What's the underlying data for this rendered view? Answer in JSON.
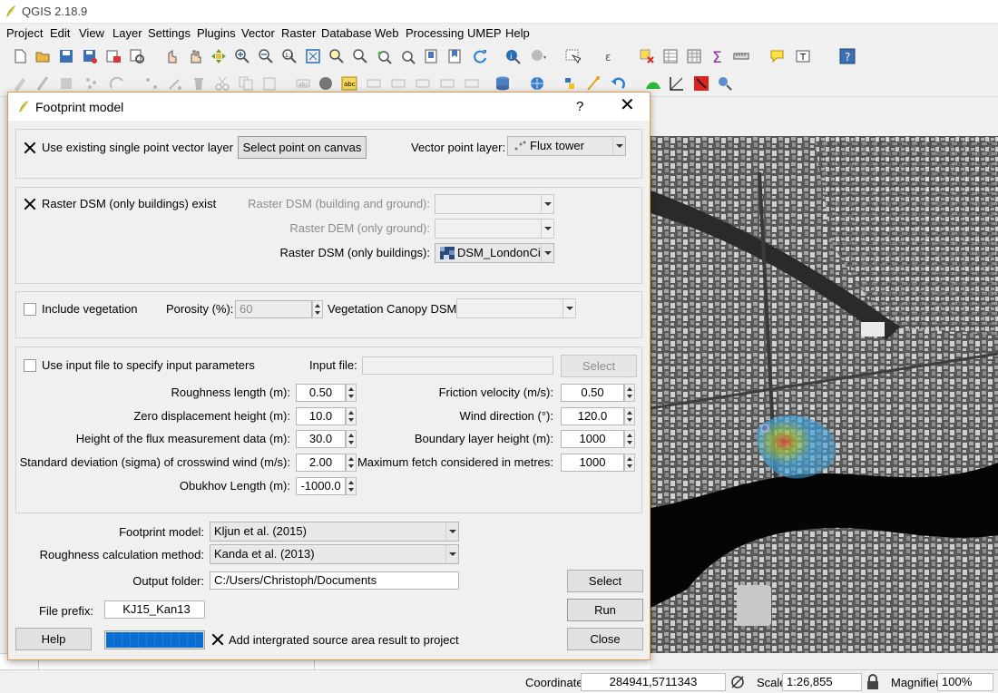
{
  "app": {
    "title": "QGIS 2.18.9",
    "icon": "qgis-logo"
  },
  "menu": [
    "Project",
    "Edit",
    "View",
    "Layer",
    "Settings",
    "Plugins",
    "Vector",
    "Raster",
    "Database",
    "Web",
    "Processing",
    "UMEP",
    "Help"
  ],
  "dialog": {
    "title": "Footprint model",
    "help_glyph": "?",
    "close_glyph": "✕",
    "point_group": {
      "use_existing_label": "Use existing single point vector layer",
      "use_existing_checked": true,
      "select_point_button": "Select point on canvas",
      "vector_layer_label": "Vector point layer:",
      "vector_layer_value": "Flux tower"
    },
    "dsm_group": {
      "dsm_exist_label": "Raster DSM (only buildings) exist",
      "dsm_exist_checked": true,
      "dsm_bg_label": "Raster DSM (building and ground):",
      "dem_label": "Raster DEM (only ground):",
      "dsm_b_label": "Raster DSM (only buildings):",
      "dsm_b_value": "DSM_LondonCity"
    },
    "veg_group": {
      "veg_label": "Include vegetation",
      "porosity_label": "Porosity (%):",
      "porosity_value": "60",
      "cdsm_label": "Vegetation Canopy DSM:"
    },
    "params_group": {
      "input_file_cb_label": "Use input file to specify input parameters",
      "input_file_label": "Input file:",
      "select_button": "Select",
      "left": [
        {
          "label": "Roughness length (m):",
          "value": "0.50"
        },
        {
          "label": "Zero displacement height (m):",
          "value": "10.0"
        },
        {
          "label": "Height of the flux measurement data (m):",
          "value": "30.0"
        },
        {
          "label": "Standard deviation (sigma) of crosswind wind (m/s):",
          "value": "2.00"
        },
        {
          "label": "Obukhov Length (m):",
          "value": "-1000.0"
        }
      ],
      "right": [
        {
          "label": "Friction velocity (m/s):",
          "value": "0.50"
        },
        {
          "label": "Wind direction (°):",
          "value": "120.0"
        },
        {
          "label": "Boundary layer height (m):",
          "value": "1000"
        },
        {
          "label": "Maximum fetch considered in metres:",
          "value": "1000"
        }
      ]
    },
    "footprint_model_label": "Footprint model:",
    "footprint_model_value": "Kljun et al. (2015)",
    "roughness_method_label": "Roughness calculation method:",
    "roughness_method_value": "Kanda et al. (2013)",
    "output_folder_label": "Output folder:",
    "output_folder_value": "C:/Users/Christoph/Documents",
    "output_select_button": "Select",
    "file_prefix_label": "File prefix:",
    "file_prefix_value": "KJ15_Kan13",
    "run_button": "Run",
    "help_button": "Help",
    "close_button": "Close",
    "progress": 1.0,
    "add_result_label": "Add intergrated source area result to project",
    "add_result_checked": true
  },
  "status": {
    "coordinate_label": "Coordinate",
    "coordinate_value": "284941,5711343",
    "scale_label": "Scale",
    "scale_value": "1:26,855",
    "magnifier_label": "Magnifier",
    "magnifier_value": "100%"
  },
  "colors": {
    "dialog_border": "#e09a48",
    "progress": "#0a6ed1",
    "footprint": "#3fa0d8"
  }
}
